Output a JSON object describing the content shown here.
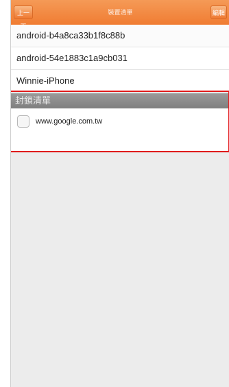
{
  "nav": {
    "back_label": "上一頁",
    "title": "裝置清單",
    "right_label": "編輯"
  },
  "devices": [
    {
      "name": "android-b4a8ca33b1f8c88b"
    },
    {
      "name": "android-54e1883c1a9cb031"
    },
    {
      "name": "Winnie-iPhone"
    }
  ],
  "blocked": {
    "header": "封鎖清單",
    "items": [
      {
        "label": "www.google.com.tw",
        "checked": false
      }
    ]
  },
  "colors": {
    "accent": "#f07c32",
    "highlight": "#e01b1b",
    "section_header": "#8a8a8a",
    "background": "#ececec"
  }
}
